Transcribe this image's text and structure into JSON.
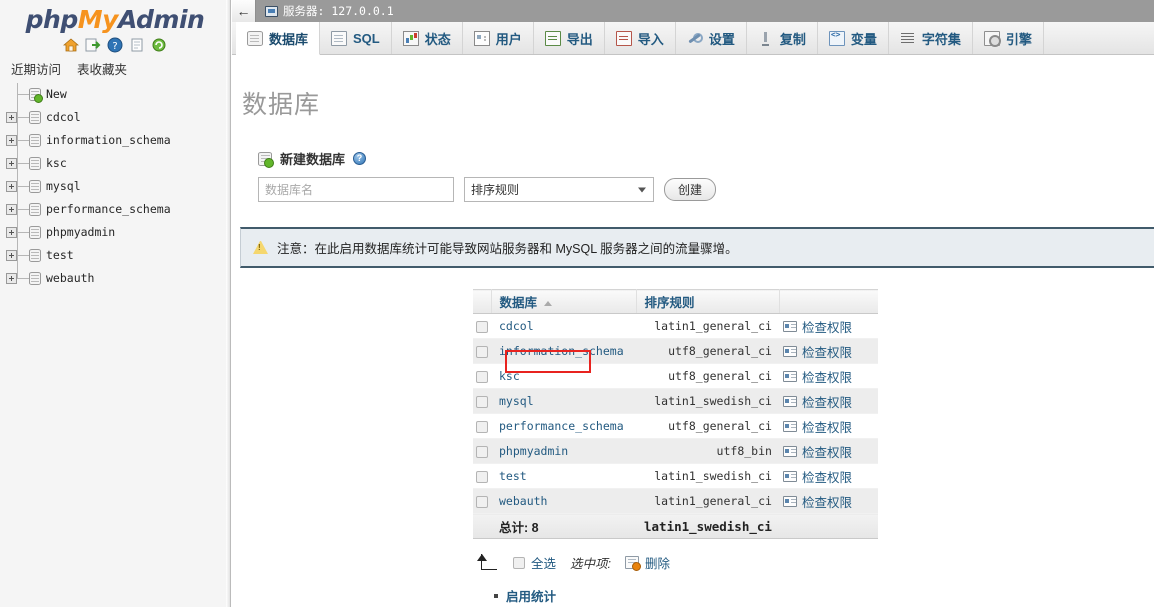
{
  "brand": {
    "php": "php",
    "my": "My",
    "admin": "Admin"
  },
  "sidebar": {
    "quick_icons": [
      "home-icon",
      "query-window-icon",
      "help-icon",
      "documentation-icon",
      "reload-icon"
    ],
    "tabs": [
      {
        "label": "近期访问",
        "name": "recent"
      },
      {
        "label": "表收藏夹",
        "name": "favorites"
      }
    ],
    "tree": [
      {
        "label": "New",
        "expandable": false,
        "new": true
      },
      {
        "label": "cdcol",
        "expandable": true,
        "new": false
      },
      {
        "label": "information_schema",
        "expandable": true,
        "new": false
      },
      {
        "label": "ksc",
        "expandable": true,
        "new": false
      },
      {
        "label": "mysql",
        "expandable": true,
        "new": false
      },
      {
        "label": "performance_schema",
        "expandable": true,
        "new": false
      },
      {
        "label": "phpmyadmin",
        "expandable": true,
        "new": false
      },
      {
        "label": "test",
        "expandable": true,
        "new": false
      },
      {
        "label": "webauth",
        "expandable": true,
        "new": false
      }
    ]
  },
  "serverbar": {
    "back_label": "←",
    "server_text": "服务器: 127.0.0.1"
  },
  "tabs": [
    {
      "label": "数据库",
      "icon": "database-icon",
      "active": true
    },
    {
      "label": "SQL",
      "icon": "sql-page-icon",
      "active": false
    },
    {
      "label": "状态",
      "icon": "status-chart-icon",
      "active": false
    },
    {
      "label": "用户",
      "icon": "users-icon",
      "active": false
    },
    {
      "label": "导出",
      "icon": "export-icon",
      "active": false
    },
    {
      "label": "导入",
      "icon": "import-icon",
      "active": false
    },
    {
      "label": "设置",
      "icon": "wrench-icon",
      "active": false
    },
    {
      "label": "复制",
      "icon": "replication-icon",
      "active": false
    },
    {
      "label": "变量",
      "icon": "variables-icon",
      "active": false
    },
    {
      "label": "字符集",
      "icon": "charset-icon",
      "active": false
    },
    {
      "label": "引擎",
      "icon": "engine-icon",
      "active": false
    }
  ],
  "page": {
    "title": "数据库"
  },
  "create_form": {
    "heading": "新建数据库",
    "help_glyph": "?",
    "dbname_placeholder": "数据库名",
    "dbname_value": "",
    "collation_selected": "排序规则",
    "create_label": "创建"
  },
  "notice": {
    "text": "注意：在此启用数据库统计可能导致网站服务器和 MySQL 服务器之间的流量骤增。"
  },
  "table": {
    "headers": {
      "check": "",
      "name": "数据库",
      "collation": "排序规则",
      "action": ""
    },
    "sort_direction": "asc",
    "rows": [
      {
        "name": "cdcol",
        "collation": "latin1_general_ci",
        "action": "检查权限",
        "highlighted": false
      },
      {
        "name": "information_schema",
        "collation": "utf8_general_ci",
        "action": "检查权限",
        "highlighted": false
      },
      {
        "name": "ksc",
        "collation": "utf8_general_ci",
        "action": "检查权限",
        "highlighted": true
      },
      {
        "name": "mysql",
        "collation": "latin1_swedish_ci",
        "action": "检查权限",
        "highlighted": false
      },
      {
        "name": "performance_schema",
        "collation": "utf8_general_ci",
        "action": "检查权限",
        "highlighted": false
      },
      {
        "name": "phpmyadmin",
        "collation": "utf8_bin",
        "action": "检查权限",
        "highlighted": false
      },
      {
        "name": "test",
        "collation": "latin1_swedish_ci",
        "action": "检查权限",
        "highlighted": false
      },
      {
        "name": "webauth",
        "collation": "latin1_general_ci",
        "action": "检查权限",
        "highlighted": false
      }
    ],
    "total": {
      "label": "总计: 8",
      "collation": "latin1_swedish_ci"
    }
  },
  "footer": {
    "select_all": "全选",
    "with_selected": "选中项:",
    "delete": "删除",
    "enable_stats": "启用统计"
  },
  "colors": {
    "link": "#235a81",
    "highlight": "#e8231f",
    "brand_orange": "#f6931e",
    "brand_navy": "#3f4f73",
    "notice_bg": "#e8edf1",
    "notice_border": "#415b6b"
  }
}
